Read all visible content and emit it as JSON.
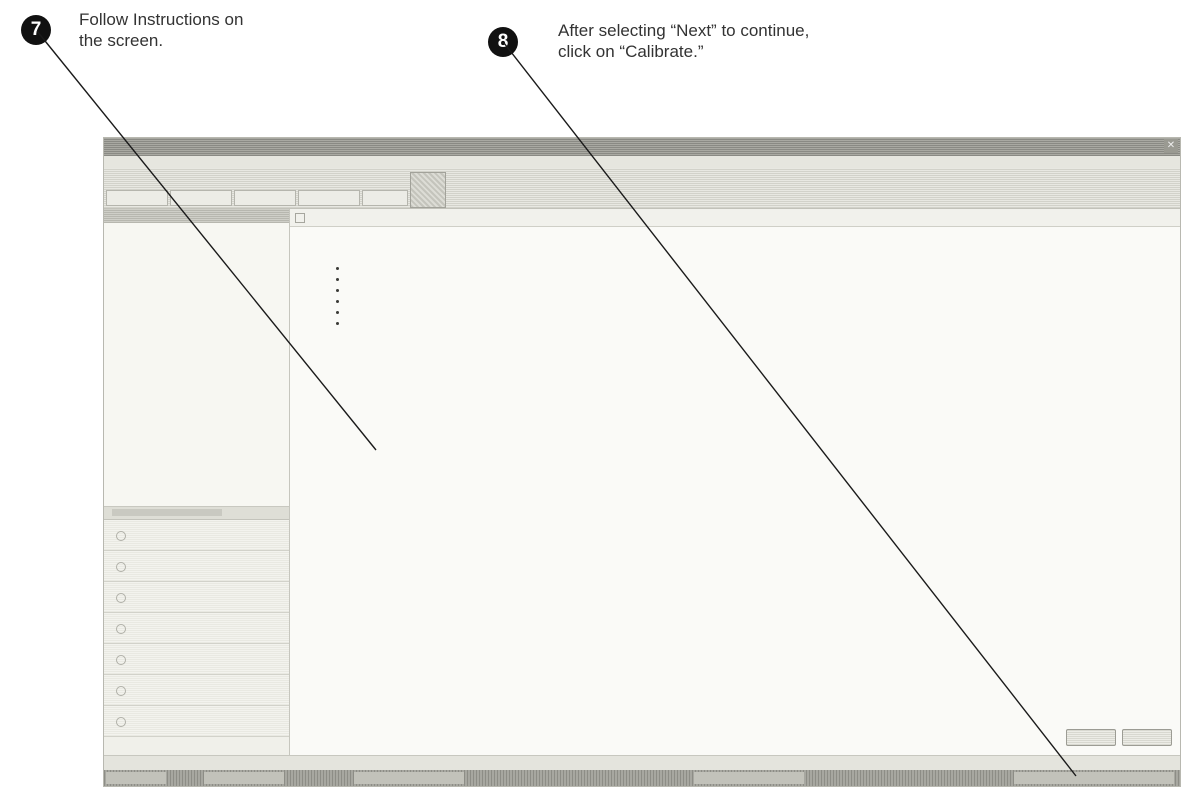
{
  "callouts": [
    {
      "number": "7",
      "lines": [
        "Follow Instructions on",
        "the screen."
      ]
    },
    {
      "number": "8",
      "lines": [
        "After selecting “Next” to continue,",
        "click on “Calibrate.”"
      ]
    }
  ],
  "app": {
    "window_title": "",
    "tree_items": [
      "",
      "",
      "",
      "",
      "",
      "",
      "",
      "",
      ""
    ],
    "nav_items": [
      "",
      "",
      "",
      "",
      "",
      "",
      ""
    ],
    "panel_title": "",
    "section_title": "",
    "paragraph1": "",
    "paragraph2": "",
    "instructions_heading": "",
    "instructions": [
      "",
      "",
      "",
      "",
      "",
      ""
    ],
    "caution": "",
    "buttons": {
      "next": "",
      "cancel": ""
    }
  }
}
